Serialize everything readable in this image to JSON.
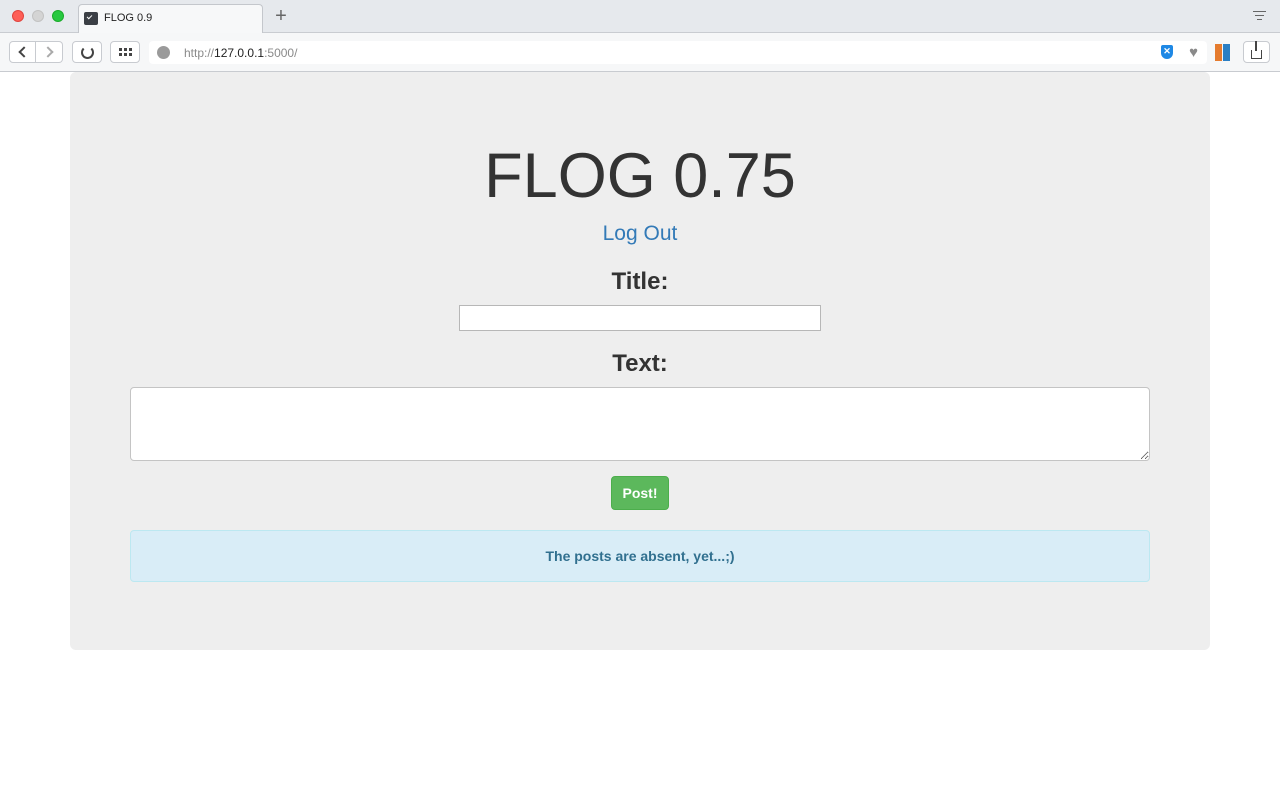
{
  "browser": {
    "tab": {
      "title": "FLOG 0.9",
      "new_tab_symbol": "+"
    },
    "url": {
      "scheme": "http://",
      "host": "127.0.0.1",
      "rest": ":5000/"
    },
    "icons": [
      "back-icon",
      "forward-icon",
      "reload-icon",
      "top-sites-icon",
      "globe-icon",
      "shield-extension-icon",
      "heart-icon",
      "books-extension-icon",
      "share-icon",
      "tab-menu-icon"
    ]
  },
  "page": {
    "title": "FLOG 0.75",
    "logout_label": "Log Out",
    "form": {
      "title_label": "Title:",
      "title_value": "",
      "text_label": "Text:",
      "text_value": "",
      "submit_label": "Post!"
    },
    "empty_message": "The posts are absent, yet...;)"
  },
  "colors": {
    "link": "#337ab7",
    "button_success": "#5cb85c",
    "alert_info_bg": "#d9edf7",
    "alert_info_text": "#31708f",
    "jumbotron_bg": "#eeeeee"
  }
}
